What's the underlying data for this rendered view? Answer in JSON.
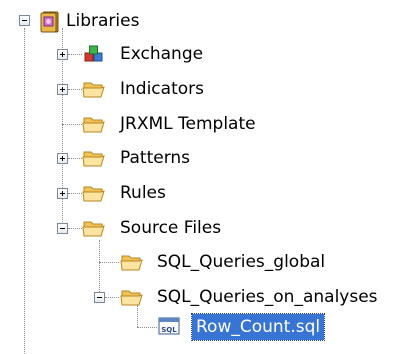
{
  "tree": {
    "root": {
      "label": "Libraries",
      "icon": "library-book-icon",
      "state": "expanded"
    },
    "items": [
      {
        "label": "Exchange",
        "icon": "exchange-cubes-icon",
        "state": "collapsed"
      },
      {
        "label": "Indicators",
        "icon": "folder-icon",
        "state": "collapsed"
      },
      {
        "label": "JRXML Template",
        "icon": "folder-icon",
        "state": "leaf"
      },
      {
        "label": "Patterns",
        "icon": "folder-icon",
        "state": "collapsed"
      },
      {
        "label": "Rules",
        "icon": "folder-icon",
        "state": "collapsed"
      },
      {
        "label": "Source Files",
        "icon": "folder-icon",
        "state": "expanded",
        "children": [
          {
            "label": "SQL_Queries_global",
            "icon": "folder-icon",
            "state": "leaf"
          },
          {
            "label": "SQL_Queries_on_analyses",
            "icon": "folder-icon",
            "state": "expanded",
            "children": [
              {
                "label": "Row_Count.sql",
                "icon": "sql-file-icon",
                "state": "leaf",
                "selected": true
              }
            ]
          }
        ]
      }
    ]
  },
  "colors": {
    "selection_bg": "#3874d4",
    "folder_fill": "#f7d98b",
    "folder_stroke": "#c9962c",
    "tree_lines": "#8a8a8a"
  }
}
